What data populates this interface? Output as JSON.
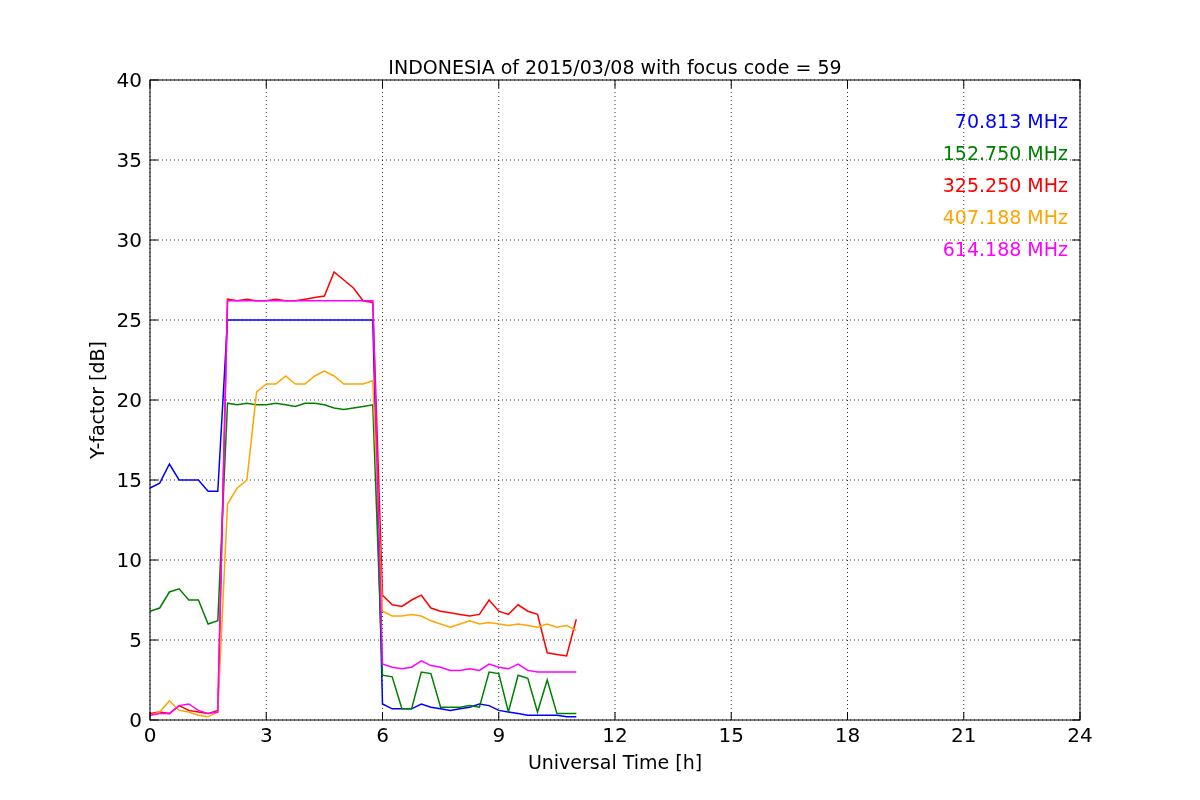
{
  "figure": {
    "chart_data": {
      "type": "line",
      "title": "INDONESIA of 2015/03/08 with focus code = 59",
      "xlabel": "Universal Time [h]",
      "ylabel": "Y-factor [dB]",
      "xlim": [
        0,
        24
      ],
      "ylim": [
        0,
        40
      ],
      "xticks": [
        0,
        3,
        6,
        9,
        12,
        15,
        18,
        21,
        24
      ],
      "yticks": [
        0,
        5,
        10,
        15,
        20,
        25,
        30,
        35,
        40
      ],
      "grid": true,
      "x": [
        0,
        0.25,
        0.5,
        0.75,
        1,
        1.25,
        1.5,
        1.75,
        2,
        2.25,
        2.5,
        2.75,
        3,
        3.25,
        3.5,
        3.75,
        4,
        4.25,
        4.5,
        4.75,
        5,
        5.25,
        5.5,
        5.75,
        6,
        6.25,
        6.5,
        6.75,
        7,
        7.25,
        7.5,
        7.75,
        8,
        8.25,
        8.5,
        8.75,
        9,
        9.25,
        9.5,
        9.75,
        10,
        10.25,
        10.5,
        10.75,
        11
      ],
      "series": [
        {
          "name": "70.813 MHz",
          "color": "#0000ff",
          "values": [
            14.5,
            14.8,
            16,
            15,
            15,
            15,
            14.3,
            14.3,
            25,
            25,
            25,
            25,
            25,
            25,
            25,
            25,
            25,
            25,
            25,
            25,
            25,
            25,
            25,
            25,
            1,
            0.7,
            0.7,
            0.7,
            1,
            0.8,
            0.7,
            0.6,
            0.7,
            0.8,
            1,
            0.9,
            0.6,
            0.5,
            0.4,
            0.3,
            0.3,
            0.3,
            0.3,
            0.2,
            0.2
          ]
        },
        {
          "name": "152.750 MHz",
          "color": "#008000",
          "values": [
            6.8,
            7,
            8,
            8.2,
            7.5,
            7.5,
            6,
            6.2,
            19.8,
            19.7,
            19.8,
            19.7,
            19.7,
            19.8,
            19.7,
            19.6,
            19.8,
            19.8,
            19.7,
            19.5,
            19.4,
            19.5,
            19.6,
            19.7,
            2.8,
            2.7,
            0.7,
            0.7,
            3,
            2.9,
            0.8,
            0.8,
            0.8,
            0.9,
            0.8,
            3,
            2.9,
            0.5,
            2.8,
            2.6,
            0.5,
            2.5,
            0.4,
            0.4,
            0.4
          ]
        },
        {
          "name": "325.250 MHz",
          "color": "#ff0000",
          "values": [
            0.4,
            0.5,
            0.4,
            0.9,
            0.6,
            0.5,
            0.4,
            0.6,
            26.3,
            26.2,
            26.3,
            26.2,
            26.2,
            26.3,
            26.2,
            26.2,
            26.3,
            26.4,
            26.5,
            28,
            27.5,
            27,
            26.2,
            26.1,
            7.8,
            7.2,
            7.1,
            7.5,
            7.8,
            7,
            6.8,
            6.7,
            6.6,
            6.5,
            6.6,
            7.5,
            6.8,
            6.6,
            7.2,
            6.8,
            6.6,
            4.2,
            4.1,
            4,
            6.3
          ]
        },
        {
          "name": "407.188 MHz",
          "color": "#ffa500",
          "values": [
            0.3,
            0.5,
            1.2,
            0.6,
            0.5,
            0.3,
            0.2,
            0.5,
            13.5,
            14.5,
            15,
            20.5,
            21,
            21,
            21.5,
            21,
            21,
            21.5,
            21.8,
            21.5,
            21,
            21,
            21,
            21.2,
            6.8,
            6.5,
            6.5,
            6.6,
            6.5,
            6.2,
            6,
            5.8,
            6,
            6.2,
            6,
            6.1,
            6,
            5.9,
            6,
            5.9,
            5.8,
            6,
            5.8,
            5.9,
            5.6
          ]
        },
        {
          "name": "614.188 MHz",
          "color": "#ff00ff",
          "values": [
            0.3,
            0.4,
            0.4,
            0.9,
            1,
            0.6,
            0.4,
            0.5,
            26.2,
            26.2,
            26.2,
            26.2,
            26.2,
            26.2,
            26.2,
            26.2,
            26.2,
            26.2,
            26.2,
            26.2,
            26.2,
            26.2,
            26.2,
            26.2,
            3.5,
            3.3,
            3.2,
            3.3,
            3.7,
            3.4,
            3.3,
            3.1,
            3.1,
            3.2,
            3.1,
            3.5,
            3.3,
            3.2,
            3.5,
            3.1,
            3,
            3,
            3,
            3,
            3
          ]
        }
      ]
    }
  }
}
